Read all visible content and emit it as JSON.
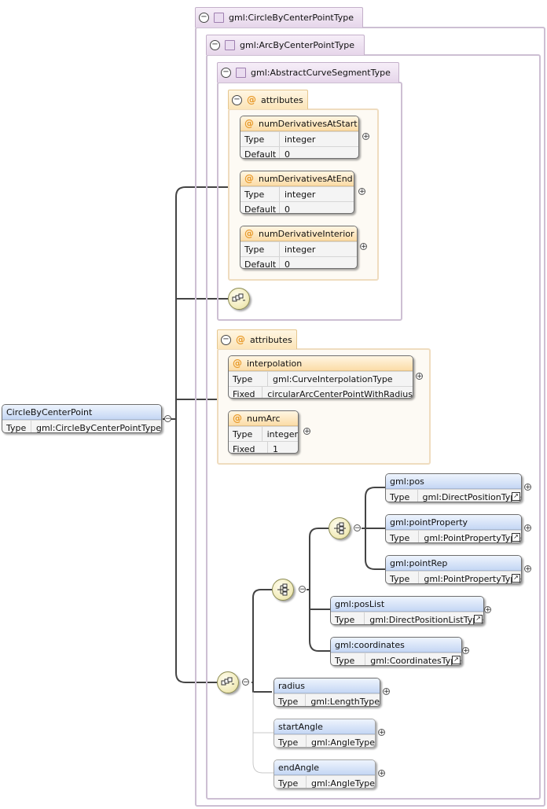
{
  "root": {
    "name": "CircleByCenterPoint",
    "type_label": "Type",
    "type": "gml:CircleByCenterPointType"
  },
  "groups": {
    "outer": "gml:CircleByCenterPointType",
    "arc": "gml:ArcByCenterPointType",
    "abstract": "gml:AbstractCurveSegmentType"
  },
  "attr_tabs": {
    "inner": "attributes",
    "outer": "attributes"
  },
  "icons": {
    "group": "minus-icon",
    "complex": "complex-type-icon",
    "attr": "at-icon",
    "expand": "plus-icon",
    "ref": "reference-arrow-icon",
    "sequence": "sequence-compositor-icon",
    "choice": "choice-compositor-icon"
  },
  "abstract_attributes": [
    {
      "name": "numDerivativesAtStart",
      "rows": [
        {
          "label": "Type",
          "value": "integer"
        },
        {
          "label": "Default",
          "value": "0"
        }
      ]
    },
    {
      "name": "numDerivativesAtEnd",
      "rows": [
        {
          "label": "Type",
          "value": "integer"
        },
        {
          "label": "Default",
          "value": "0"
        }
      ]
    },
    {
      "name": "numDerivativeInterior",
      "rows": [
        {
          "label": "Type",
          "value": "integer"
        },
        {
          "label": "Default",
          "value": "0"
        }
      ]
    }
  ],
  "arc_attributes": [
    {
      "name": "interpolation",
      "rows": [
        {
          "label": "Type",
          "value": "gml:CurveInterpolationType"
        },
        {
          "label": "Fixed",
          "value": "circularArcCenterPointWithRadius"
        }
      ]
    },
    {
      "name": "numArc",
      "rows": [
        {
          "label": "Type",
          "value": "integer"
        },
        {
          "label": "Fixed",
          "value": "1"
        }
      ]
    }
  ],
  "choice_elements": [
    {
      "name": "gml:pos",
      "type_label": "Type",
      "type": "gml:DirectPositionType"
    },
    {
      "name": "gml:pointProperty",
      "type_label": "Type",
      "type": "gml:PointPropertyType"
    },
    {
      "name": "gml:pointRep",
      "type_label": "Type",
      "type": "gml:PointPropertyType"
    },
    {
      "name": "gml:posList",
      "type_label": "Type",
      "type": "gml:DirectPositionListType"
    },
    {
      "name": "gml:coordinates",
      "type_label": "Type",
      "type": "gml:CoordinatesType"
    }
  ],
  "sequence_elements": [
    {
      "name": "radius",
      "type_label": "Type",
      "type": "gml:LengthType"
    },
    {
      "name": "startAngle",
      "type_label": "Type",
      "type": "gml:AngleType"
    },
    {
      "name": "endAngle",
      "type_label": "Type",
      "type": "gml:AngleType"
    }
  ]
}
